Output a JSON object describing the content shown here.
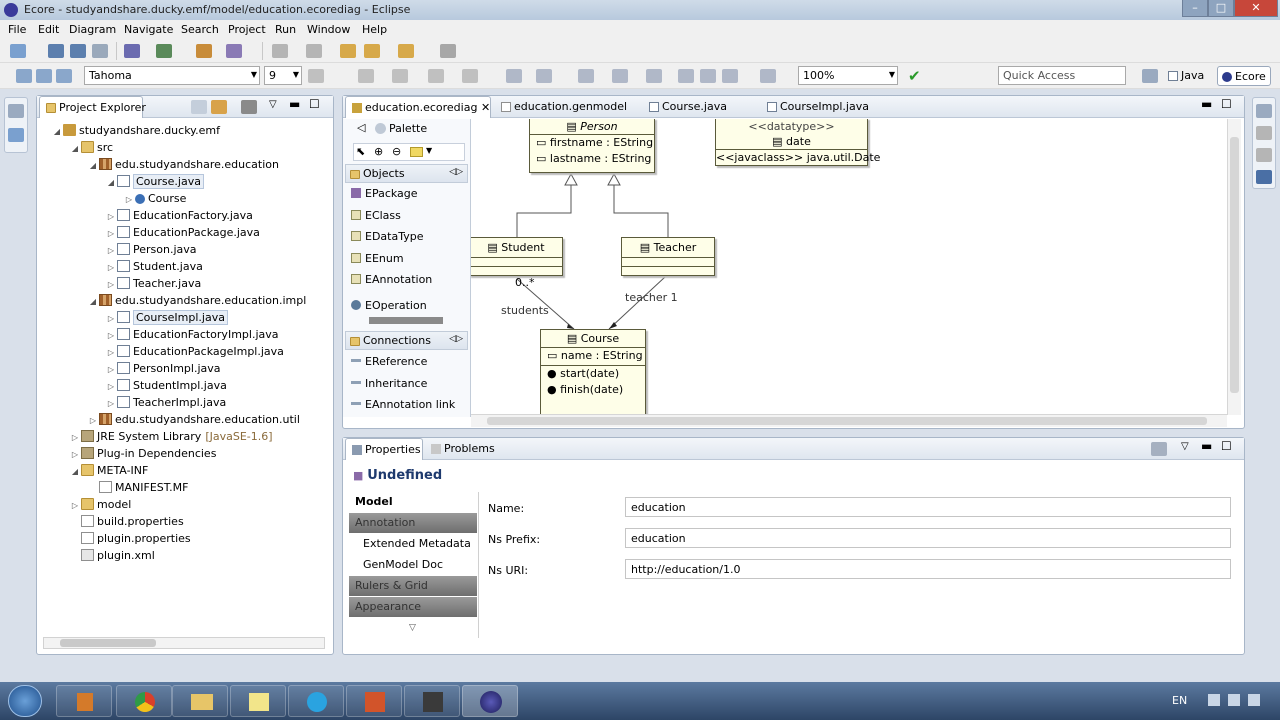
{
  "window": {
    "title": "Ecore - studyandshare.ducky.emf/model/education.ecorediag - Eclipse",
    "controls": [
      "–",
      "□",
      "✕"
    ]
  },
  "menu": [
    "File",
    "Edit",
    "Diagram",
    "Navigate",
    "Search",
    "Project",
    "Run",
    "Window",
    "Help"
  ],
  "toolbar": {
    "font": "Tahoma",
    "font_size": "9",
    "zoom": "100%",
    "quick_access_placeholder": "Quick Access",
    "perspectives": [
      "Java",
      "Ecore"
    ]
  },
  "explorer": {
    "tab": "Project Explorer",
    "rows": [
      {
        "label": "studyandshare.ducky.emf",
        "depth": 0,
        "twisty": "◢",
        "icon": "project"
      },
      {
        "label": "src",
        "depth": 1,
        "twisty": "◢",
        "icon": "folder"
      },
      {
        "label": "edu.studyandshare.education",
        "depth": 2,
        "twisty": "◢",
        "icon": "package"
      },
      {
        "label": "Course.java",
        "depth": 3,
        "twisty": "◢",
        "icon": "java",
        "selected": true
      },
      {
        "label": "Course",
        "depth": 4,
        "twisty": "▷",
        "icon": "class"
      },
      {
        "label": "EducationFactory.java",
        "depth": 3,
        "twisty": "▷",
        "icon": "java"
      },
      {
        "label": "EducationPackage.java",
        "depth": 3,
        "twisty": "▷",
        "icon": "java"
      },
      {
        "label": "Person.java",
        "depth": 3,
        "twisty": "▷",
        "icon": "java"
      },
      {
        "label": "Student.java",
        "depth": 3,
        "twisty": "▷",
        "icon": "java"
      },
      {
        "label": "Teacher.java",
        "depth": 3,
        "twisty": "▷",
        "icon": "java"
      },
      {
        "label": "edu.studyandshare.education.impl",
        "depth": 2,
        "twisty": "◢",
        "icon": "package"
      },
      {
        "label": "CourseImpl.java",
        "depth": 3,
        "twisty": "▷",
        "icon": "java",
        "selected": true
      },
      {
        "label": "EducationFactoryImpl.java",
        "depth": 3,
        "twisty": "▷",
        "icon": "java"
      },
      {
        "label": "EducationPackageImpl.java",
        "depth": 3,
        "twisty": "▷",
        "icon": "java"
      },
      {
        "label": "PersonImpl.java",
        "depth": 3,
        "twisty": "▷",
        "icon": "java"
      },
      {
        "label": "StudentImpl.java",
        "depth": 3,
        "twisty": "▷",
        "icon": "java"
      },
      {
        "label": "TeacherImpl.java",
        "depth": 3,
        "twisty": "▷",
        "icon": "java"
      },
      {
        "label": "edu.studyandshare.education.util",
        "depth": 2,
        "twisty": "▷",
        "icon": "package"
      },
      {
        "label": "JRE System Library",
        "suffix": "[JavaSE-1.6]",
        "depth": 1,
        "twisty": "▷",
        "icon": "jar"
      },
      {
        "label": "Plug-in Dependencies",
        "depth": 1,
        "twisty": "▷",
        "icon": "jar"
      },
      {
        "label": "META-INF",
        "depth": 1,
        "twisty": "◢",
        "icon": "folder"
      },
      {
        "label": "MANIFEST.MF",
        "depth": 2,
        "twisty": "",
        "icon": "file"
      },
      {
        "label": "model",
        "depth": 1,
        "twisty": "▷",
        "icon": "folder"
      },
      {
        "label": "build.properties",
        "depth": 1,
        "twisty": "",
        "icon": "file"
      },
      {
        "label": "plugin.properties",
        "depth": 1,
        "twisty": "",
        "icon": "file"
      },
      {
        "label": "plugin.xml",
        "depth": 1,
        "twisty": "",
        "icon": "xml"
      }
    ]
  },
  "editor": {
    "tabs": [
      "education.ecorediag",
      "education.genmodel",
      "Course.java",
      "CourseImpl.java"
    ],
    "palette": {
      "title": "Palette",
      "objects_header": "Objects",
      "objects": [
        "EPackage",
        "EClass",
        "EDataType",
        "EEnum",
        "EAnnotation",
        "EOperation"
      ],
      "connections_header": "Connections",
      "connections": [
        "EReference",
        "Inheritance",
        "EAnnotation link"
      ]
    },
    "diagram": {
      "person": {
        "name": "Person",
        "attrs": [
          "firstname : EString",
          "lastname : EString"
        ]
      },
      "datatype": {
        "stereo": "<<datatype>>",
        "name": "date",
        "attr": "<<javaclass>> java.util.Date"
      },
      "student": {
        "name": "Student"
      },
      "teacher": {
        "name": "Teacher"
      },
      "course": {
        "name": "Course",
        "attrs": [
          "name : EString"
        ],
        "ops": [
          "start(date)",
          "finish(date)"
        ]
      },
      "labels": {
        "students_mult": "0..*",
        "students": "students",
        "teacher": "teacher 1"
      }
    }
  },
  "properties": {
    "tabs": [
      "Properties",
      "Problems"
    ],
    "heading": "Undefined",
    "categories": [
      "Model",
      "Annotation",
      "Extended Metadata",
      "GenModel Doc",
      "Rulers & Grid",
      "Appearance"
    ],
    "fields": [
      {
        "label": "Name:",
        "value": "education"
      },
      {
        "label": "Ns Prefix:",
        "value": "education"
      },
      {
        "label": "Ns URI:",
        "value": "http://education/1.0"
      }
    ]
  },
  "taskbar": {
    "language": "EN"
  }
}
